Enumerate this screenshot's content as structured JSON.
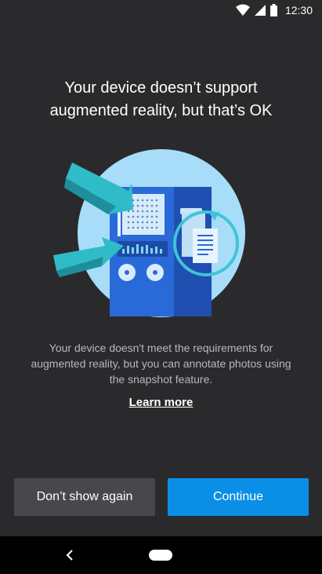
{
  "status_bar": {
    "time": "12:30",
    "icons": [
      "wifi-icon",
      "signal-icon",
      "battery-icon"
    ]
  },
  "dialog": {
    "title_line1": "Your device doesn’t support",
    "title_line2": "augmented reality, but that’s OK",
    "body_line1": "Your device doesn't meet the requirements for",
    "body_line2": "augmented reality, but you can annotate photos using",
    "body_line3": "the snapshot feature.",
    "learn_more_label": "Learn more"
  },
  "buttons": {
    "secondary_label": "Don’t show again",
    "primary_label": "Continue"
  },
  "nav_bar": {
    "icons": [
      "back-icon",
      "home-pill"
    ]
  },
  "colors": {
    "background": "#2a2a2d",
    "primary_button": "#0b8fe6",
    "secondary_button": "#48484c"
  }
}
